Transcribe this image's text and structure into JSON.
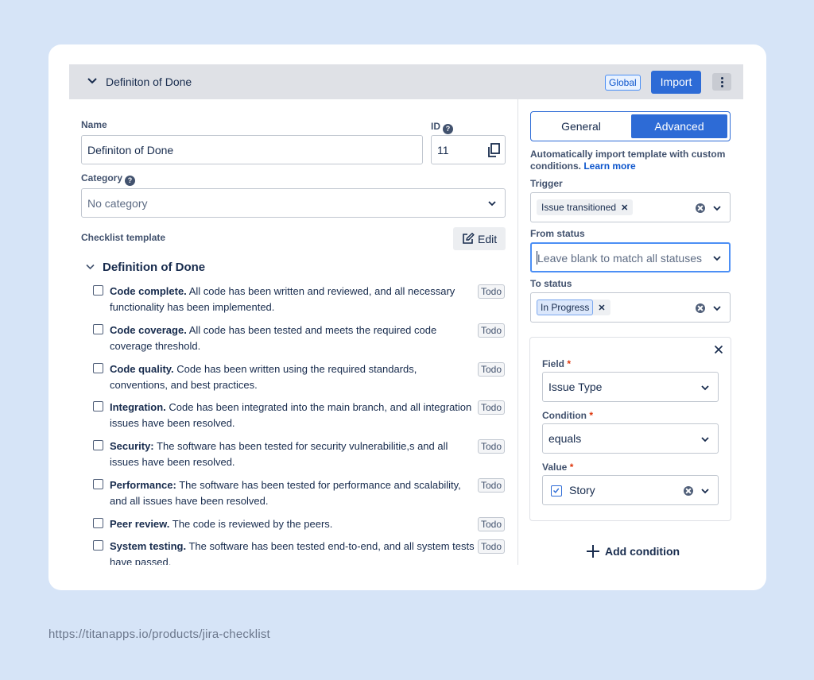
{
  "header": {
    "title": "Definiton of Done",
    "global_badge": "Global",
    "import_label": "Import"
  },
  "form": {
    "name_label": "Name",
    "name_value": "Definiton of Done",
    "id_label": "ID",
    "id_value": "11",
    "category_label": "Category",
    "category_value": "No category",
    "checklist_label": "Checklist template",
    "edit_label": "Edit"
  },
  "checklist": {
    "section_title": "Definition of Done",
    "items": [
      {
        "title": "Code complete.",
        "desc": " All code has been written and reviewed, and all necessary functionality has been implemented.",
        "status": "Todo"
      },
      {
        "title": "Code coverage.",
        "desc": " All code has been tested and meets the required code coverage threshold.",
        "status": "Todo"
      },
      {
        "title": "Code quality.",
        "desc": " Code has been written using the required standards, conventions, and best practices.",
        "status": "Todo"
      },
      {
        "title": "Integration.",
        "desc": " Code has been integrated into the main branch, and all integration issues have been resolved.",
        "status": "Todo"
      },
      {
        "title": "Security:",
        "desc": " The software has been tested for security vulnerabilitie,s and all issues have been resolved.",
        "status": "Todo"
      },
      {
        "title": "Performance:",
        "desc": " The software has been tested for performance and scalability, and all issues have been resolved.",
        "status": "Todo"
      },
      {
        "title": "Peer review.",
        "desc": " The code is reviewed by the peers.",
        "status": "Todo"
      },
      {
        "title": "System testing.",
        "desc": " The software has been tested end-to-end, and all system tests have passed.",
        "status": "Todo"
      }
    ]
  },
  "tabs": {
    "general": "General",
    "advanced": "Advanced"
  },
  "advanced": {
    "description": "Automatically import template with custom conditions.",
    "learn_more": "Learn more",
    "trigger_label": "Trigger",
    "trigger_value": "Issue transitioned",
    "from_status_label": "From status",
    "from_status_placeholder": "Leave blank to match all statuses",
    "to_status_label": "To status",
    "to_status_value": "In Progress",
    "field_label": "Field",
    "field_value": "Issue Type",
    "condition_label": "Condition",
    "condition_value": "equals",
    "value_label": "Value",
    "value_value": "Story",
    "required_mark": "*",
    "add_condition": "Add condition"
  },
  "footer_url": "https://titanapps.io/products/jira-checklist",
  "colors": {
    "background": "#d6e4f7",
    "primary": "#2d6bd6",
    "header": "#dfe1e6"
  }
}
